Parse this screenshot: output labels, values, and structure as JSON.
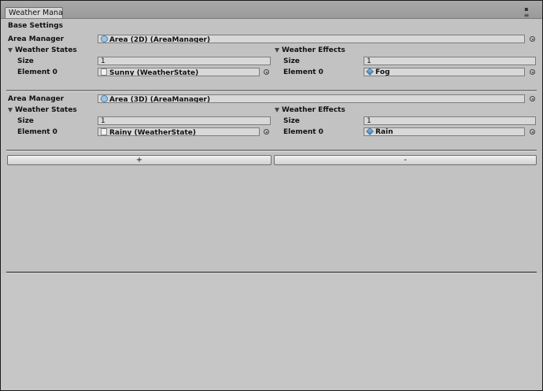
{
  "window": {
    "tab_title": "Weather Manag"
  },
  "base_settings": {
    "header": "Base Settings"
  },
  "blocks": [
    {
      "area_manager_label": "Area Manager",
      "area_manager_value": "Area (2D) (AreaManager)",
      "weather_states": {
        "header": "Weather States",
        "size_label": "Size",
        "size_value": "1",
        "element_label": "Element 0",
        "element_value": "Sunny (WeatherState)"
      },
      "weather_effects": {
        "header": "Weather Effects",
        "size_label": "Size",
        "size_value": "1",
        "element_label": "Element 0",
        "element_value": "Fog"
      }
    },
    {
      "area_manager_label": "Area Manager",
      "area_manager_value": "Area (3D) (AreaManager)",
      "weather_states": {
        "header": "Weather States",
        "size_label": "Size",
        "size_value": "1",
        "element_label": "Element 0",
        "element_value": "Rainy (WeatherState)"
      },
      "weather_effects": {
        "header": "Weather Effects",
        "size_label": "Size",
        "size_value": "1",
        "element_label": "Element 0",
        "element_value": "Rain"
      }
    }
  ],
  "buttons": {
    "add_label": "+",
    "remove_label": "-"
  },
  "icons": {
    "fold": "triangle-down-icon",
    "object_picker": "object-picker-icon",
    "script": "script-icon",
    "asset": "asset-icon",
    "prefab": "prefab-cube-icon"
  }
}
